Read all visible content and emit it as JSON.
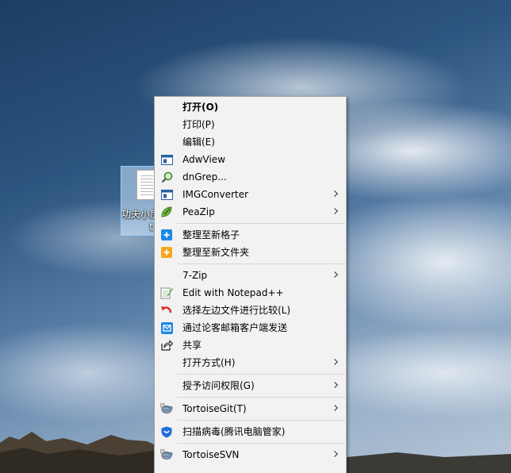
{
  "desktop": {
    "icon": {
      "label": "功夫小房",
      "label_line2": "t"
    }
  },
  "colors": {
    "menu_bg": "#f2f2f2",
    "selection": "#cce8ff",
    "separator": "#d7d7d7"
  },
  "menu": {
    "groups": [
      [
        {
          "label": "打开(O)",
          "bold": true,
          "icon": null,
          "submenu": false
        },
        {
          "label": "打印(P)",
          "icon": null,
          "submenu": false
        },
        {
          "label": "编辑(E)",
          "icon": null,
          "submenu": false
        },
        {
          "label": "AdwView",
          "icon": "adwview-icon",
          "submenu": false
        },
        {
          "label": "dnGrep...",
          "icon": "magnifier-icon",
          "submenu": false
        },
        {
          "label": "IMGConverter",
          "icon": "imgconverter-icon",
          "submenu": true
        },
        {
          "label": "PeaZip",
          "icon": "peazip-icon",
          "submenu": true
        }
      ],
      [
        {
          "label": "整理至新格子",
          "icon": "fences-blue-icon",
          "submenu": false
        },
        {
          "label": "整理至新文件夹",
          "icon": "fences-orange-icon",
          "submenu": false
        }
      ],
      [
        {
          "label": "7-Zip",
          "icon": null,
          "submenu": true
        },
        {
          "label": "Edit with Notepad++",
          "icon": "notepadpp-icon",
          "submenu": false
        },
        {
          "label": "选择左边文件进行比较(L)",
          "icon": "compare-icon",
          "submenu": false
        },
        {
          "label": "通过论客邮箱客户端发送",
          "icon": "mail-client-icon",
          "submenu": false
        },
        {
          "label": "共享",
          "icon": "share-icon",
          "submenu": false
        },
        {
          "label": "打开方式(H)",
          "icon": null,
          "submenu": true
        }
      ],
      [
        {
          "label": "授予访问权限(G)",
          "icon": null,
          "submenu": true
        }
      ],
      [
        {
          "label": "TortoiseGit(T)",
          "icon": "tortoisegit-icon",
          "submenu": true
        }
      ],
      [
        {
          "label": "扫描病毒(腾讯电脑管家)",
          "icon": "shield-icon",
          "submenu": false
        }
      ],
      [
        {
          "label": "TortoiseSVN",
          "icon": "tortoisesvn-icon",
          "submenu": true
        }
      ]
    ]
  }
}
